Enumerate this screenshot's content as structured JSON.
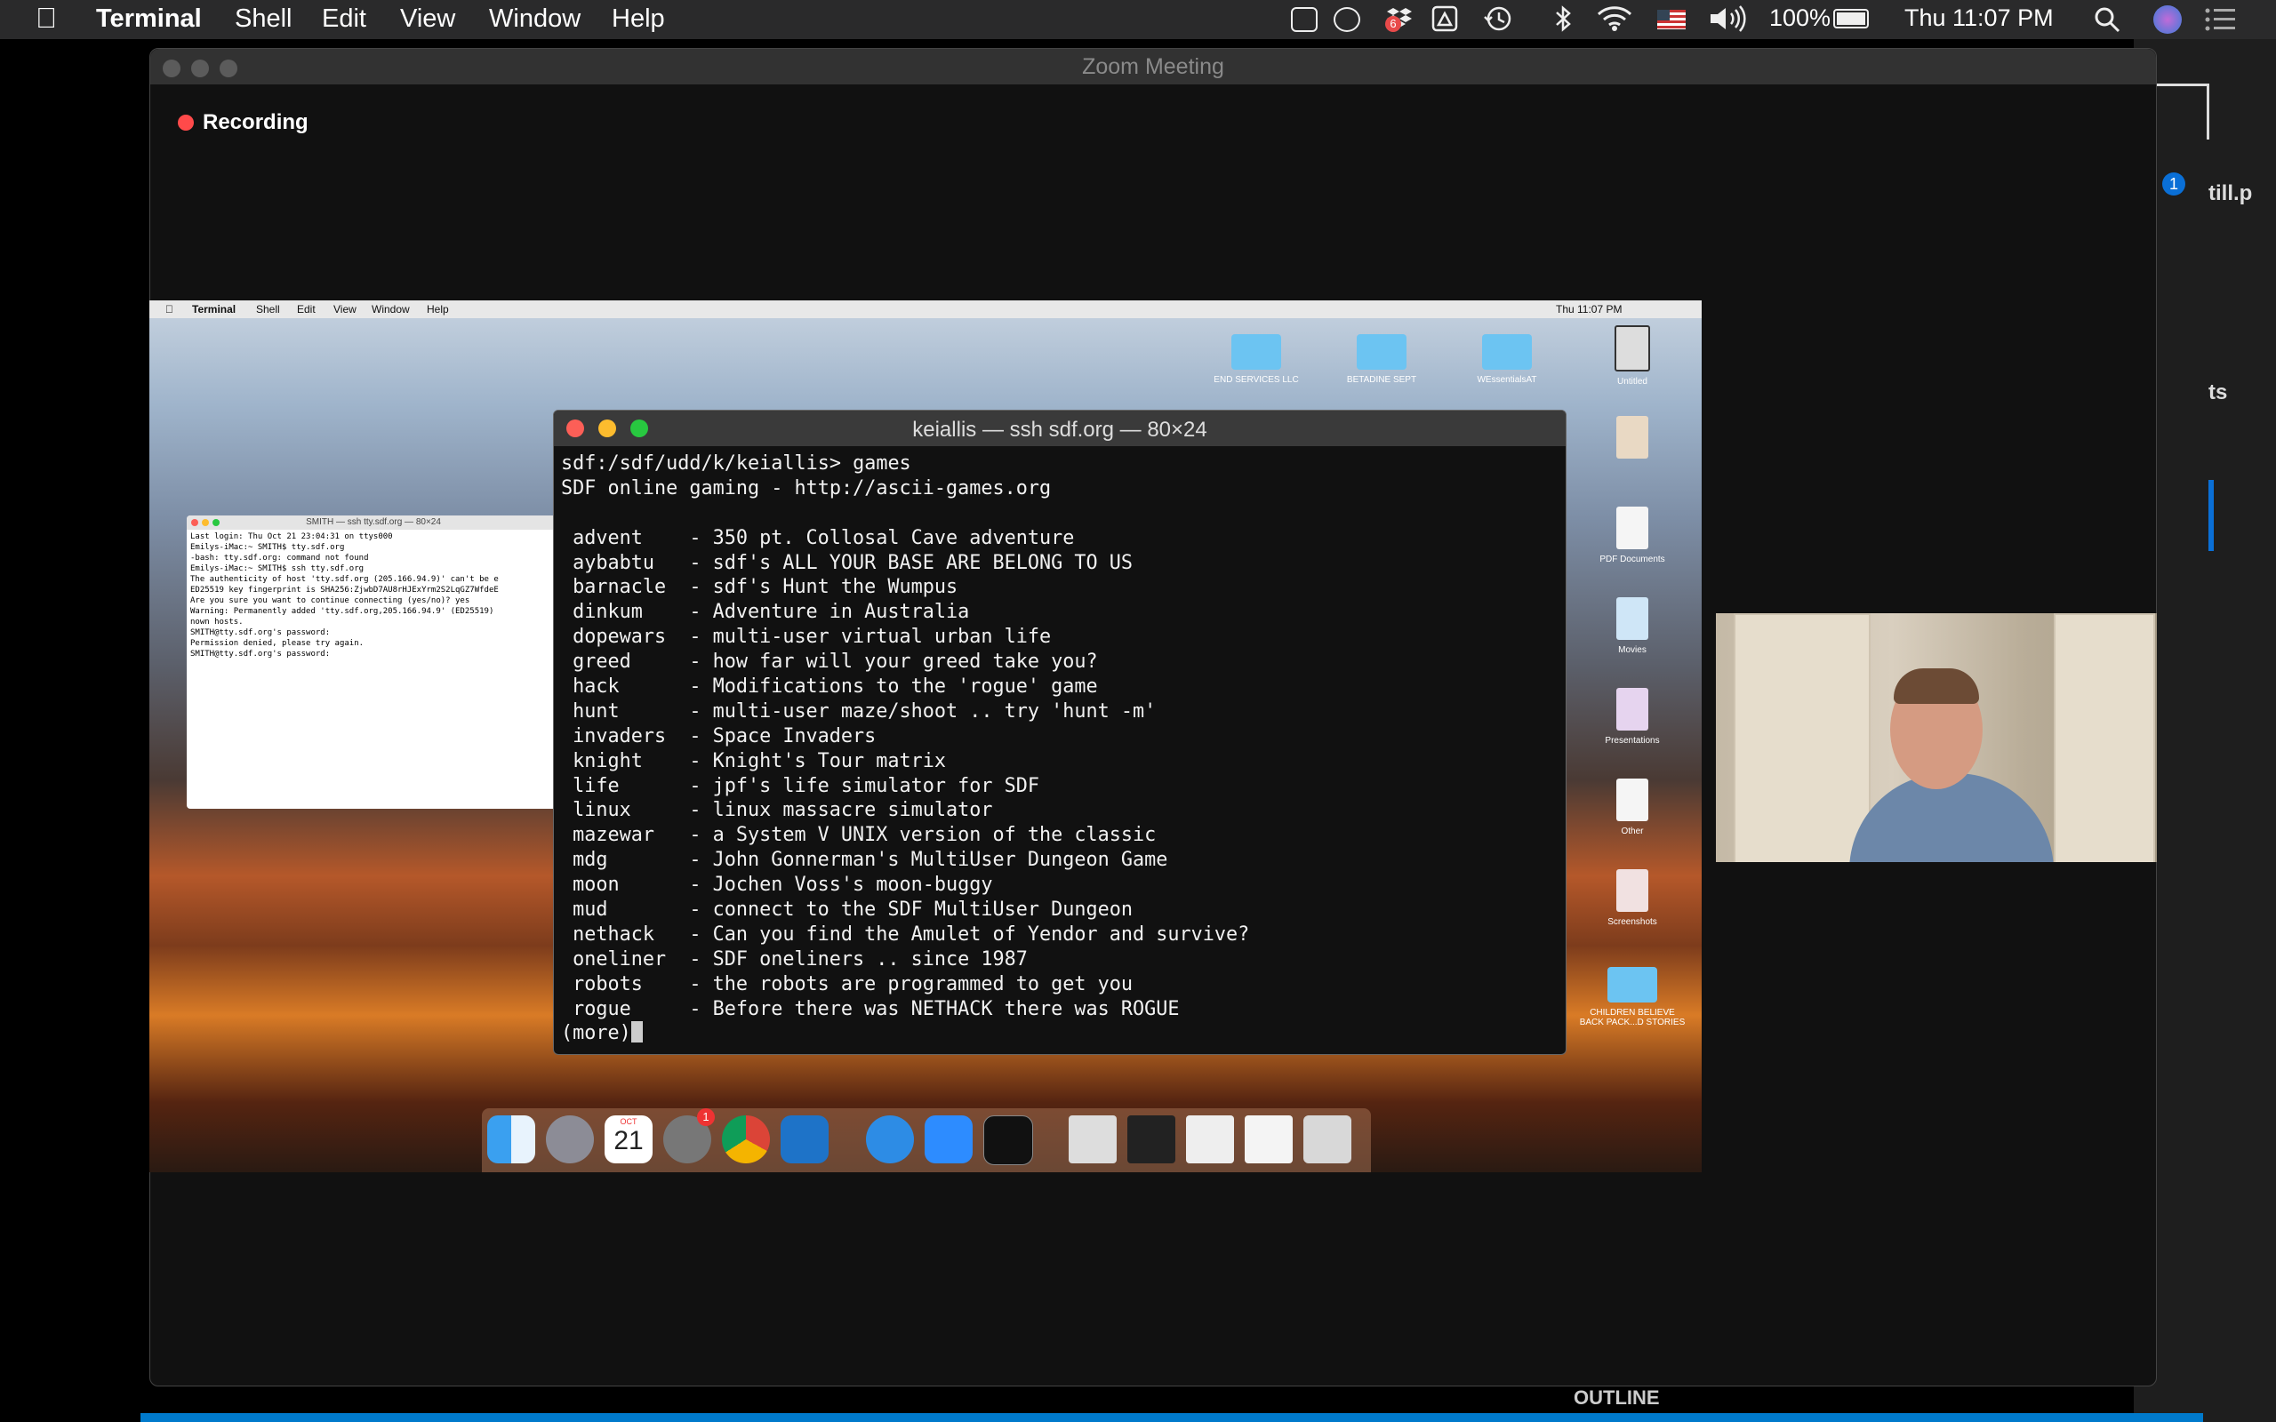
{
  "menubar": {
    "app_name": "Terminal",
    "items": [
      "Shell",
      "Edit",
      "View",
      "Window",
      "Help"
    ],
    "battery": "100%",
    "clock": "Thu 11:07 PM",
    "notification_badge": "6"
  },
  "zoom": {
    "window_title": "Zoom Meeting",
    "recording_label": "Recording"
  },
  "shared_screen": {
    "menubar": {
      "app_name": "Terminal",
      "items": [
        "Shell",
        "Edit",
        "View",
        "Window",
        "Help"
      ],
      "clock": "Thu 11:07 PM"
    },
    "desktop_items": [
      "END SERVICES LLC",
      "BETADINE SEPT",
      "WEssentialsAT",
      "Untitled",
      "PDF Documents",
      "Movies",
      "Presentations",
      "Other",
      "Screenshots",
      "CHILDREN BELIEVE BACK PACK...D STORIES"
    ],
    "small_terminal": {
      "title": "SMITH — ssh tty.sdf.org — 80×24",
      "lines": [
        "Last login: Thu Oct 21 23:04:31 on ttys000",
        "Emilys-iMac:~ SMITH$ tty.sdf.org",
        "-bash: tty.sdf.org: command not found",
        "Emilys-iMac:~ SMITH$ ssh tty.sdf.org",
        "The authenticity of host 'tty.sdf.org (205.166.94.9)' can't be e",
        "ED25519 key fingerprint is SHA256:ZjwbD7AU8rHJExYrm2S2LqGZ7WfdeE",
        "Are you sure you want to continue connecting (yes/no)? yes",
        "Warning: Permanently added 'tty.sdf.org,205.166.94.9' (ED25519)",
        "nown hosts.",
        "SMITH@tty.sdf.org's password:",
        "Permission denied, please try again.",
        "SMITH@tty.sdf.org's password:"
      ]
    },
    "terminal": {
      "title": "keiallis — ssh sdf.org — 80×24",
      "prompt": "sdf:/sdf/udd/k/keiallis> games",
      "banner": "SDF online gaming - http://ascii-games.org",
      "games": [
        {
          "name": "advent",
          "desc": "350 pt. Collosal Cave adventure"
        },
        {
          "name": "aybabtu",
          "desc": "sdf's ALL YOUR BASE ARE BELONG TO US"
        },
        {
          "name": "barnacle",
          "desc": "sdf's Hunt the Wumpus"
        },
        {
          "name": "dinkum",
          "desc": "Adventure in Australia"
        },
        {
          "name": "dopewars",
          "desc": "multi-user virtual urban life"
        },
        {
          "name": "greed",
          "desc": "how far will your greed take you?"
        },
        {
          "name": "hack",
          "desc": "Modifications to the 'rogue' game"
        },
        {
          "name": "hunt",
          "desc": "multi-user maze/shoot .. try 'hunt -m'"
        },
        {
          "name": "invaders",
          "desc": "Space Invaders"
        },
        {
          "name": "knight",
          "desc": "Knight's Tour matrix"
        },
        {
          "name": "life",
          "desc": "jpf's life simulator for SDF"
        },
        {
          "name": "linux",
          "desc": "linux massacre simulator"
        },
        {
          "name": "mazewar",
          "desc": "a System V UNIX version of the classic"
        },
        {
          "name": "mdg",
          "desc": "John Gonnerman's MultiUser Dungeon Game"
        },
        {
          "name": "moon",
          "desc": "Jochen Voss's moon-buggy"
        },
        {
          "name": "mud",
          "desc": "connect to the SDF MultiUser Dungeon"
        },
        {
          "name": "nethack",
          "desc": "Can you find the Amulet of Yendor and survive?"
        },
        {
          "name": "oneliner",
          "desc": "SDF oneliners .. since 1987"
        },
        {
          "name": "robots",
          "desc": "the robots are programmed to get you"
        },
        {
          "name": "rogue",
          "desc": "Before there was NETHACK there was ROGUE"
        }
      ],
      "more": "(more)"
    },
    "dock": {
      "calendar_month": "OCT",
      "calendar_day": "21",
      "badge": "1"
    }
  },
  "background_app": {
    "outline_label": "OUTLINE",
    "fragment_1": "till.p",
    "fragment_2": "ts",
    "badge": "1"
  }
}
